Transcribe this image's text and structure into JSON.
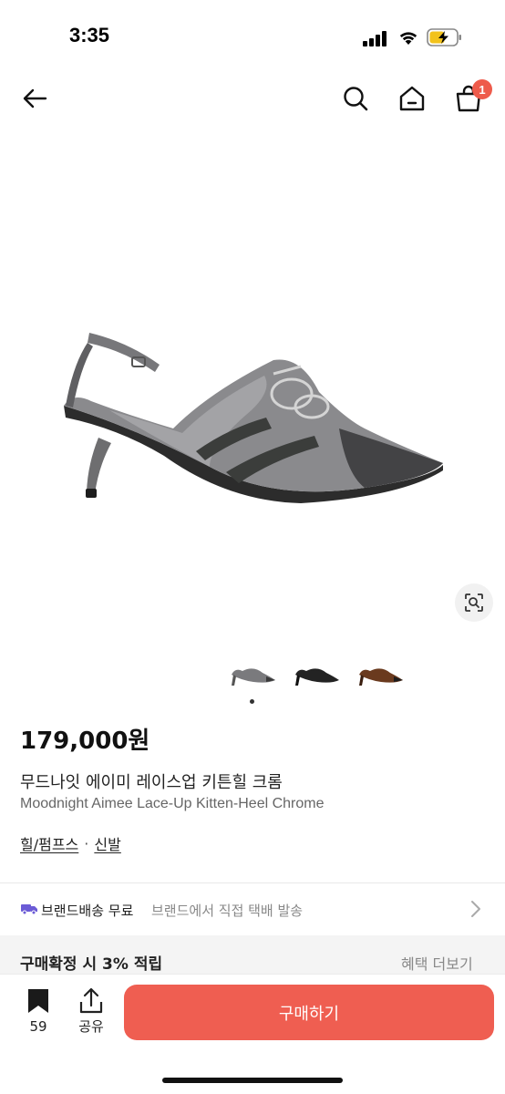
{
  "status_bar": {
    "time": "3:35"
  },
  "header": {
    "cart_badge": "1",
    "icons": [
      "back-arrow-icon",
      "search-icon",
      "home-icon",
      "shopping-bag-icon"
    ]
  },
  "product": {
    "price": "179,000원",
    "title_ko": "무드나잇 에이미 레이스업 키튼힐 크롬",
    "title_en": "Moodnight Aimee Lace-Up Kitten-Heel Chrome",
    "category_primary": "힐/펌프스",
    "category_separator": "·",
    "category_secondary": "신발",
    "thumbnails": [
      "chrome",
      "black",
      "brown"
    ],
    "image_index": 1,
    "image_count": 1
  },
  "shipping": {
    "main": "브랜드배송 무료",
    "sub": "브랜드에서 직접 택배 발송"
  },
  "reward": {
    "text": "구매확정 시 3% 적립",
    "more": "혜택 더보기"
  },
  "bottom_bar": {
    "bookmark_count": "59",
    "share_label": "공유",
    "buy_label": "구매하기"
  },
  "colors": {
    "accent": "#ef5e51",
    "badge": "#ee5b4b"
  }
}
